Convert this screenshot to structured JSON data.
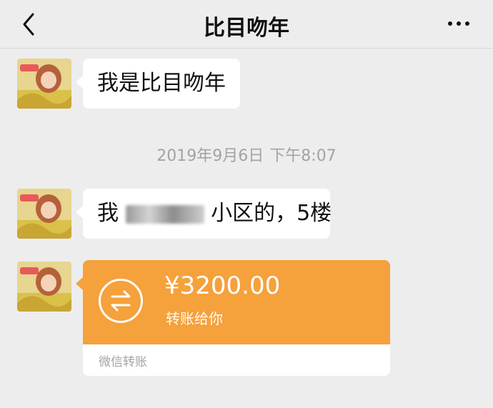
{
  "header": {
    "title": "比目吻年",
    "back_icon": "chevron-left-icon",
    "more_icon": "ellipsis-icon"
  },
  "messages": [
    {
      "text": "我是比目吻年"
    },
    {
      "timestamp_date": "2019年9月6日",
      "timestamp_time": "下午8:07"
    },
    {
      "text_start": "我",
      "text_end": "小区的，5楼"
    },
    {
      "transfer": {
        "amount": "¥3200.00",
        "subtitle": "转账给你",
        "label": "微信转账"
      }
    }
  ],
  "colors": {
    "background": "#ededed",
    "transfer_orange": "#f5a13c",
    "timestamp_gray": "#a3a3a3"
  }
}
